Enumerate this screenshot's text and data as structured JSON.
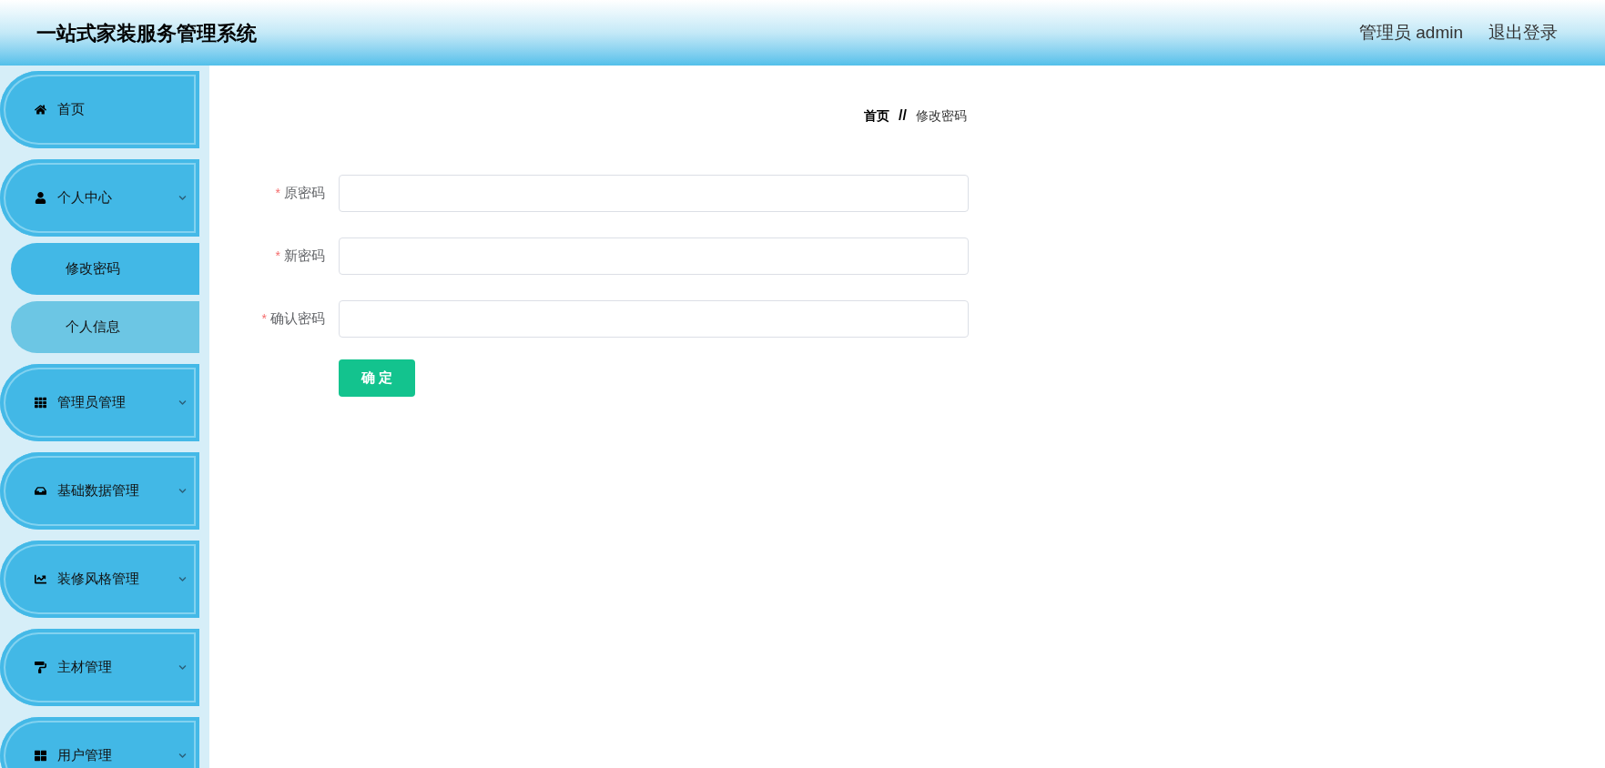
{
  "header": {
    "title": "一站式家装服务管理系统",
    "user_label": "管理员 admin",
    "logout": "退出登录"
  },
  "sidebar": {
    "items": [
      {
        "kind": "link",
        "label": "首页"
      },
      {
        "kind": "submenu",
        "label": "个人中心",
        "children": [
          {
            "label": "修改密码",
            "selected": true
          },
          {
            "label": "个人信息",
            "selected": false
          }
        ]
      },
      {
        "kind": "submenu",
        "label": "管理员管理"
      },
      {
        "kind": "submenu",
        "label": "基础数据管理"
      },
      {
        "kind": "submenu",
        "label": "装修风格管理"
      },
      {
        "kind": "submenu",
        "label": "主材管理"
      },
      {
        "kind": "submenu",
        "label": "用户管理"
      }
    ]
  },
  "breadcrumb": {
    "items": [
      "首页",
      "修改密码"
    ],
    "separator": "//"
  },
  "form": {
    "fields": [
      {
        "label": "原密码",
        "required_mark": "*"
      },
      {
        "label": "新密码",
        "required_mark": "*"
      },
      {
        "label": "确认密码",
        "required_mark": "*"
      }
    ],
    "submit": "确 定"
  }
}
